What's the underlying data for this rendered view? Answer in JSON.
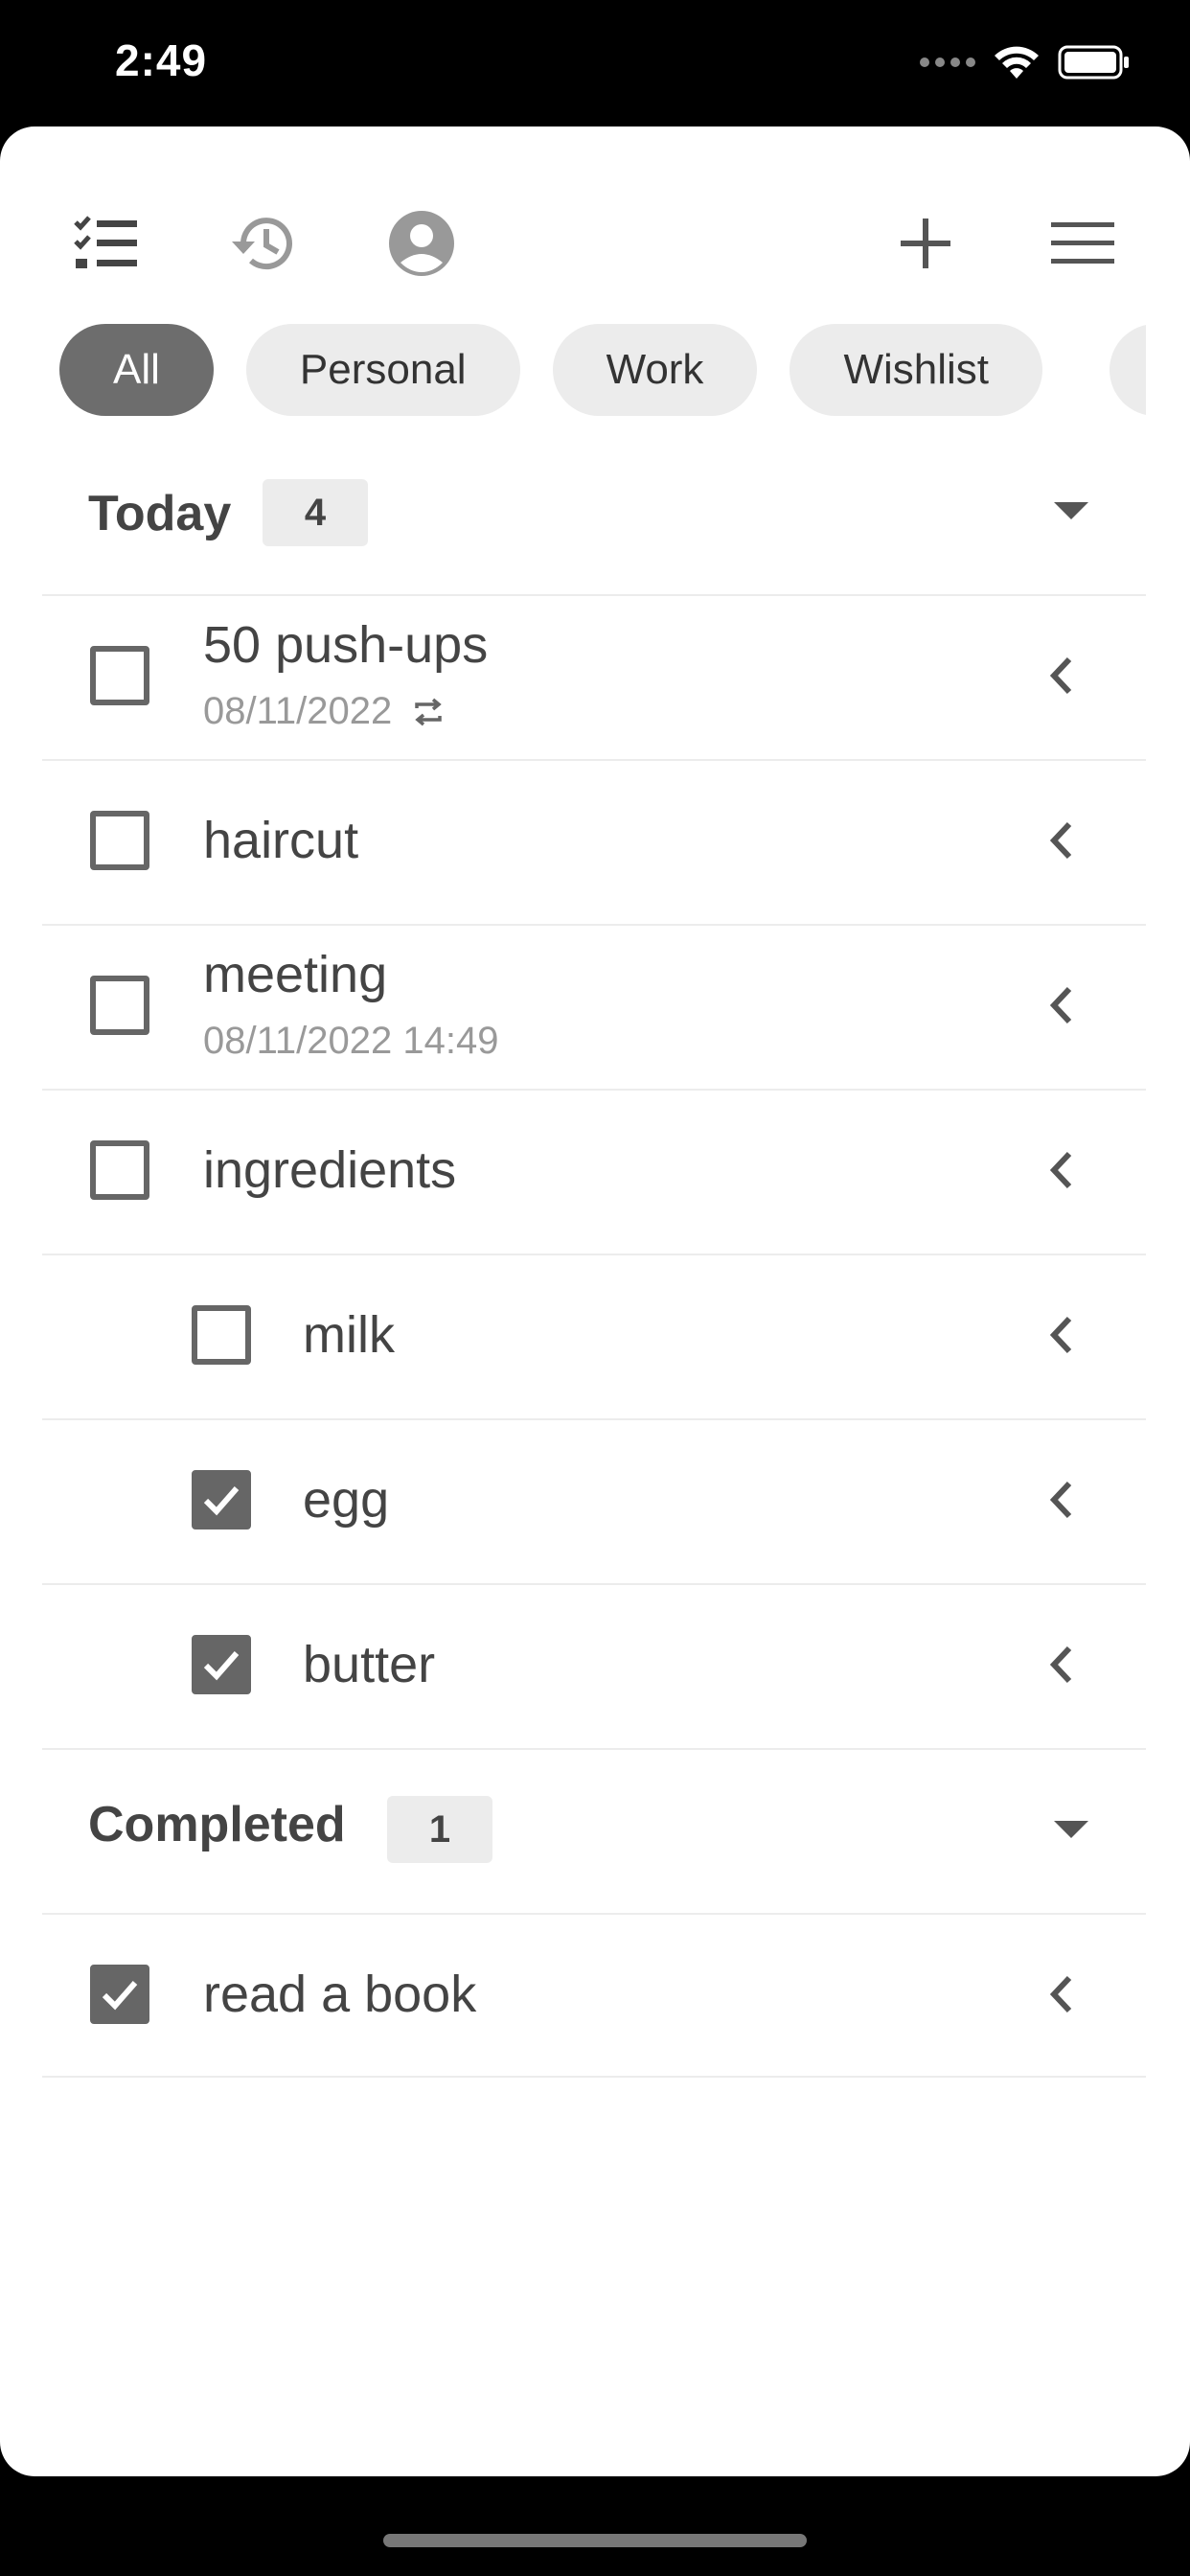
{
  "status_bar": {
    "time": "2:49"
  },
  "toolbar": {
    "icons": [
      "checklist-icon",
      "history-icon",
      "account-icon",
      "add-icon",
      "menu-icon"
    ]
  },
  "filters": {
    "chips": [
      "All",
      "Personal",
      "Work",
      "Wishlist"
    ],
    "selected": "All"
  },
  "sections": {
    "today": {
      "title": "Today",
      "count": "4",
      "tasks": [
        {
          "title": "50 push-ups",
          "subtitle": "08/11/2022",
          "repeat": true,
          "checked": false,
          "indent": 0
        },
        {
          "title": "haircut",
          "subtitle": "",
          "checked": false,
          "indent": 0
        },
        {
          "title": "meeting",
          "subtitle": "08/11/2022 14:49",
          "checked": false,
          "indent": 0
        },
        {
          "title": "ingredients",
          "subtitle": "",
          "checked": false,
          "indent": 0
        },
        {
          "title": "milk",
          "subtitle": "",
          "checked": false,
          "indent": 1
        },
        {
          "title": "egg",
          "subtitle": "",
          "checked": true,
          "indent": 1
        },
        {
          "title": "butter",
          "subtitle": "",
          "checked": true,
          "indent": 1
        }
      ]
    },
    "completed": {
      "title": "Completed",
      "count": "1",
      "tasks": [
        {
          "title": "read a book",
          "subtitle": "",
          "checked": true,
          "indent": 0
        }
      ]
    }
  },
  "colors": {
    "accent": "#6d6d6d",
    "chip_bg": "#ececec",
    "text": "#444444"
  }
}
